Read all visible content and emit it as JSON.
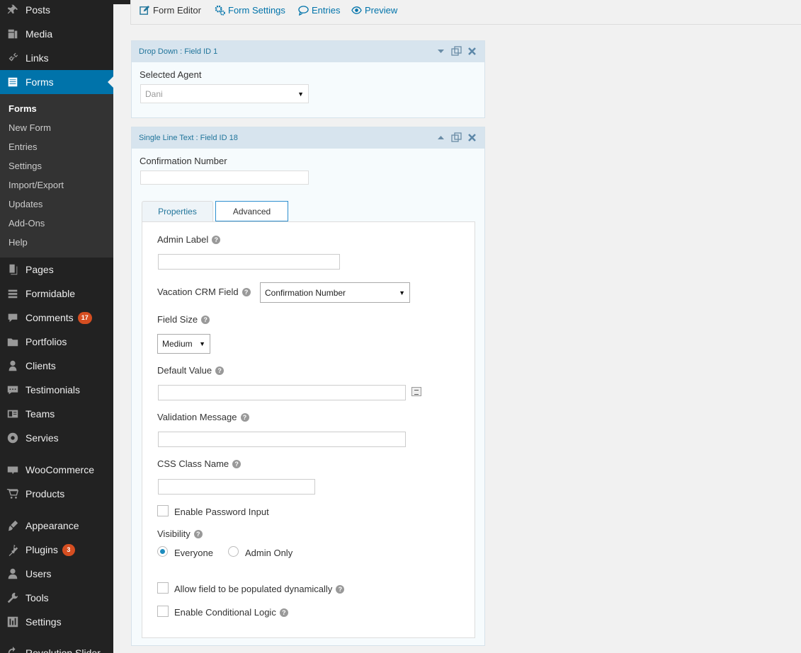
{
  "sidebar": {
    "menu": [
      {
        "label": "Posts",
        "icon": "pin-icon"
      },
      {
        "label": "Media",
        "icon": "media-icon"
      },
      {
        "label": "Links",
        "icon": "link-icon"
      },
      {
        "label": "Forms",
        "icon": "forms-icon",
        "current": true
      },
      {
        "label": "Pages",
        "icon": "pages-icon"
      },
      {
        "label": "Formidable",
        "icon": "formidable-icon"
      },
      {
        "label": "Comments",
        "icon": "comments-icon",
        "badge": "17"
      },
      {
        "label": "Portfolios",
        "icon": "folder-icon"
      },
      {
        "label": "Clients",
        "icon": "user-icon"
      },
      {
        "label": "Testimonials",
        "icon": "chat-icon"
      },
      {
        "label": "Teams",
        "icon": "teams-icon"
      },
      {
        "label": "Servies",
        "icon": "services-icon"
      },
      {
        "label": "WooCommerce",
        "icon": "woo-icon"
      },
      {
        "label": "Products",
        "icon": "cart-icon"
      },
      {
        "label": "Appearance",
        "icon": "brush-icon"
      },
      {
        "label": "Plugins",
        "icon": "plugin-icon",
        "badge": "3"
      },
      {
        "label": "Users",
        "icon": "users-icon"
      },
      {
        "label": "Tools",
        "icon": "wrench-icon"
      },
      {
        "label": "Settings",
        "icon": "settings-icon"
      },
      {
        "label": "Revolution Slider",
        "icon": "refresh-icon"
      }
    ],
    "submenu": [
      "Forms",
      "New Form",
      "Entries",
      "Settings",
      "Import/Export",
      "Updates",
      "Add-Ons",
      "Help"
    ]
  },
  "toolbar": {
    "form_editor": "Form Editor",
    "form_settings": "Form Settings",
    "entries": "Entries",
    "preview": "Preview"
  },
  "field1": {
    "header": "Drop Down : Field ID 1",
    "label": "Selected Agent",
    "select_value": "Dani"
  },
  "field2": {
    "header": "Single Line Text : Field ID 18",
    "label": "Confirmation Number",
    "tabs": {
      "properties": "Properties",
      "advanced": "Advanced"
    },
    "advanced": {
      "admin_label": "Admin Label",
      "crm_field_label": "Vacation CRM Field",
      "crm_field_value": "Confirmation Number",
      "field_size_label": "Field Size",
      "field_size_value": "Medium",
      "default_value_label": "Default Value",
      "validation_message_label": "Validation Message",
      "css_class_label": "CSS Class Name",
      "enable_password": "Enable Password Input",
      "visibility_label": "Visibility",
      "visibility_everyone": "Everyone",
      "visibility_admin": "Admin Only",
      "visibility_selected": "Everyone",
      "allow_dynamic": "Allow field to be populated dynamically",
      "enable_conditional": "Enable Conditional Logic"
    }
  },
  "colors": {
    "sidebar_bg": "#222222",
    "accent": "#0073aa",
    "badge": "#d54e21",
    "field_header_bg": "#d7e4ee"
  }
}
